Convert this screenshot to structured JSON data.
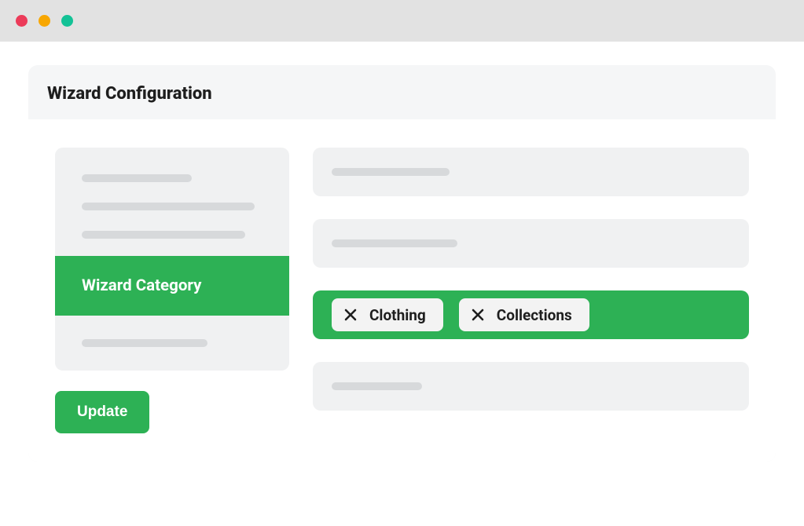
{
  "header": {
    "title": "Wizard Configuration"
  },
  "sidebar": {
    "active_label": "Wizard Category"
  },
  "chips": [
    {
      "label": "Clothing"
    },
    {
      "label": "Collections"
    }
  ],
  "actions": {
    "update_label": "Update"
  },
  "colors": {
    "accent": "#2DB155"
  }
}
